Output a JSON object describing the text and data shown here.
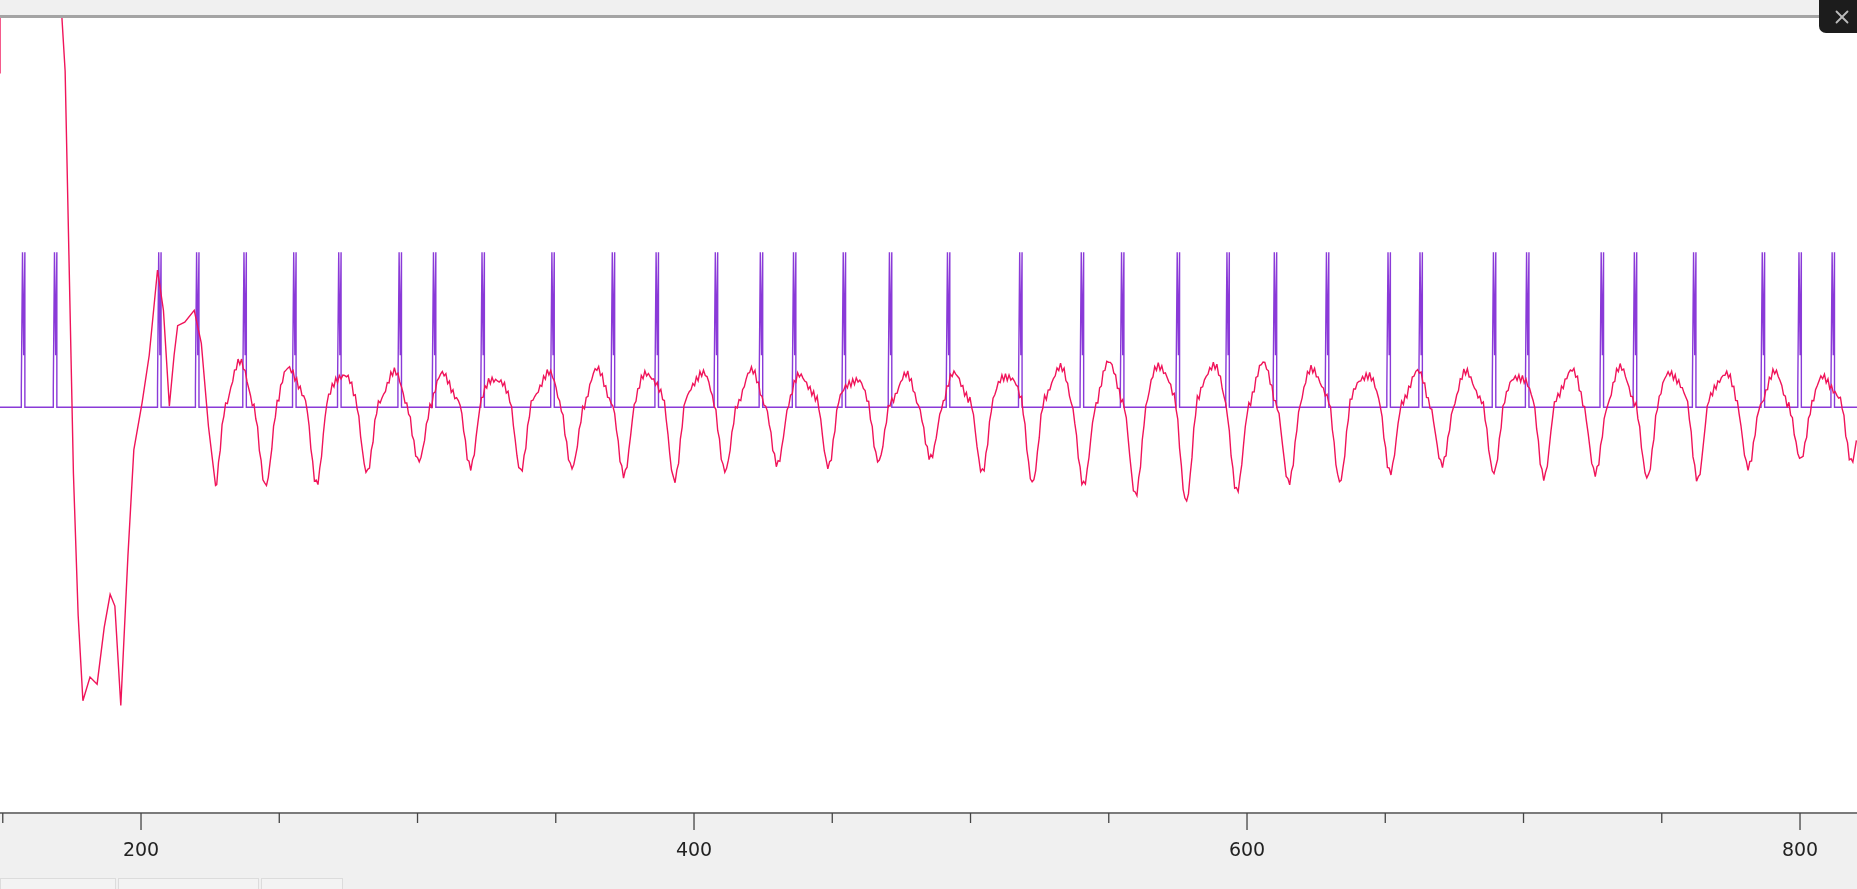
{
  "x_axis": {
    "ticks": [
      "200",
      "400",
      "600",
      "800"
    ]
  }
}
